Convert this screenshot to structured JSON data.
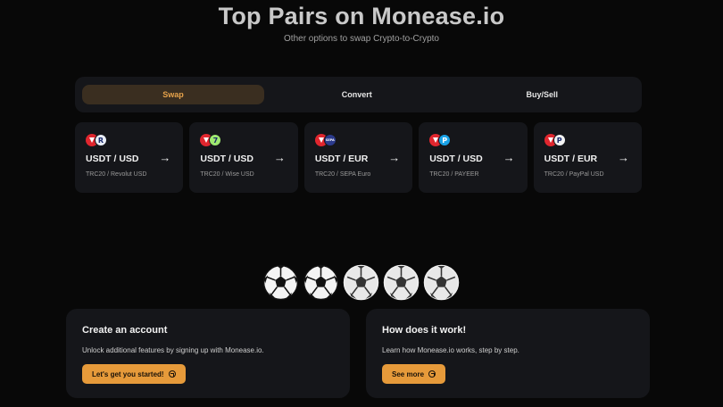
{
  "hero": {
    "title": "Top Pairs on Monease.io",
    "subtitle": "Other options to swap Crypto-to-Crypto"
  },
  "tabs": [
    {
      "label": "Swap",
      "active": true
    },
    {
      "label": "Convert",
      "active": false
    },
    {
      "label": "Buy/Sell",
      "active": false
    }
  ],
  "pairs": [
    {
      "name": "USDT / USD",
      "sub": "TRC20 / Revolut USD",
      "icon": "revolut-icon",
      "glyph": "R",
      "color": "#e9eef7"
    },
    {
      "name": "USDT / USD",
      "sub": "TRC20 / Wise USD",
      "icon": "wise-icon",
      "glyph": "7",
      "color": "#9fe870"
    },
    {
      "name": "USDT / EUR",
      "sub": "TRC20 / SEPA Euro",
      "icon": "sepa-icon",
      "glyph": "SEPA",
      "color": "#2b3a8c"
    },
    {
      "name": "USDT / USD",
      "sub": "TRC20 / PAYEER",
      "icon": "payeer-icon",
      "glyph": "P",
      "color": "#1aa3e8"
    },
    {
      "name": "USDT / EUR",
      "sub": "TRC20 / PayPal USD",
      "icon": "paypal-icon",
      "glyph": "P",
      "color": "#f2f2f2"
    }
  ],
  "cards": {
    "create": {
      "title": "Create an account",
      "text": "Unlock additional features by signing up with Monease.io.",
      "button": "Let's get you started!"
    },
    "how": {
      "title": "How does it work!",
      "text": "Learn how Monease.io works, step by step.",
      "button": "See more"
    }
  },
  "colors": {
    "accent": "#e69a3a",
    "card_bg": "#15161a",
    "bg": "#080808"
  }
}
